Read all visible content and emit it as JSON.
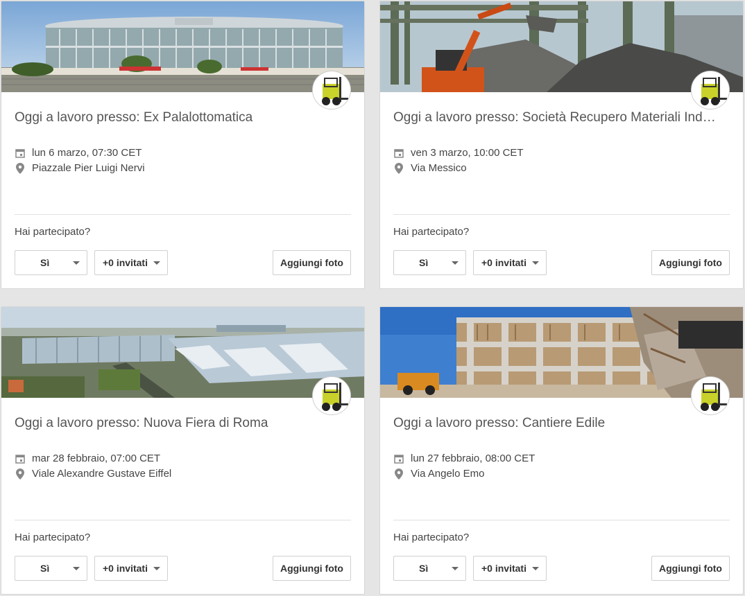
{
  "events": [
    {
      "title": "Oggi a lavoro presso: Ex Palalottomatica",
      "date": "lun 6 marzo, 07:30 CET",
      "place": "Piazzale Pier Luigi Nervi",
      "question": "Hai partecipato?",
      "rsvp": "Sì",
      "guests": "+0 invitati",
      "photo_button": "Aggiungi foto"
    },
    {
      "title": "Oggi a lavoro presso: Società Recupero Materiali Industriali",
      "date": "ven 3 marzo, 10:00 CET",
      "place": "Via Messico",
      "question": "Hai partecipato?",
      "rsvp": "Sì",
      "guests": "+0 invitati",
      "photo_button": "Aggiungi foto"
    },
    {
      "title": "Oggi a lavoro presso: Nuova Fiera di Roma",
      "date": "mar 28 febbraio, 07:00 CET",
      "place": "Viale Alexandre Gustave Eiffel",
      "question": "Hai partecipato?",
      "rsvp": "Sì",
      "guests": "+0 invitati",
      "photo_button": "Aggiungi foto"
    },
    {
      "title": "Oggi a lavoro presso: Cantiere Edile",
      "date": "lun 27 febbraio, 08:00 CET",
      "place": "Via Angelo Emo",
      "question": "Hai partecipato?",
      "rsvp": "Sì",
      "guests": "+0 invitati",
      "photo_button": "Aggiungi foto"
    }
  ],
  "icons": {
    "date": "calendar-icon",
    "place": "location-pin-icon",
    "dropdown": "caret-down-icon"
  },
  "colors": {
    "background": "#e5e5e5",
    "card": "#ffffff",
    "text": "#444444",
    "title": "#555555"
  }
}
